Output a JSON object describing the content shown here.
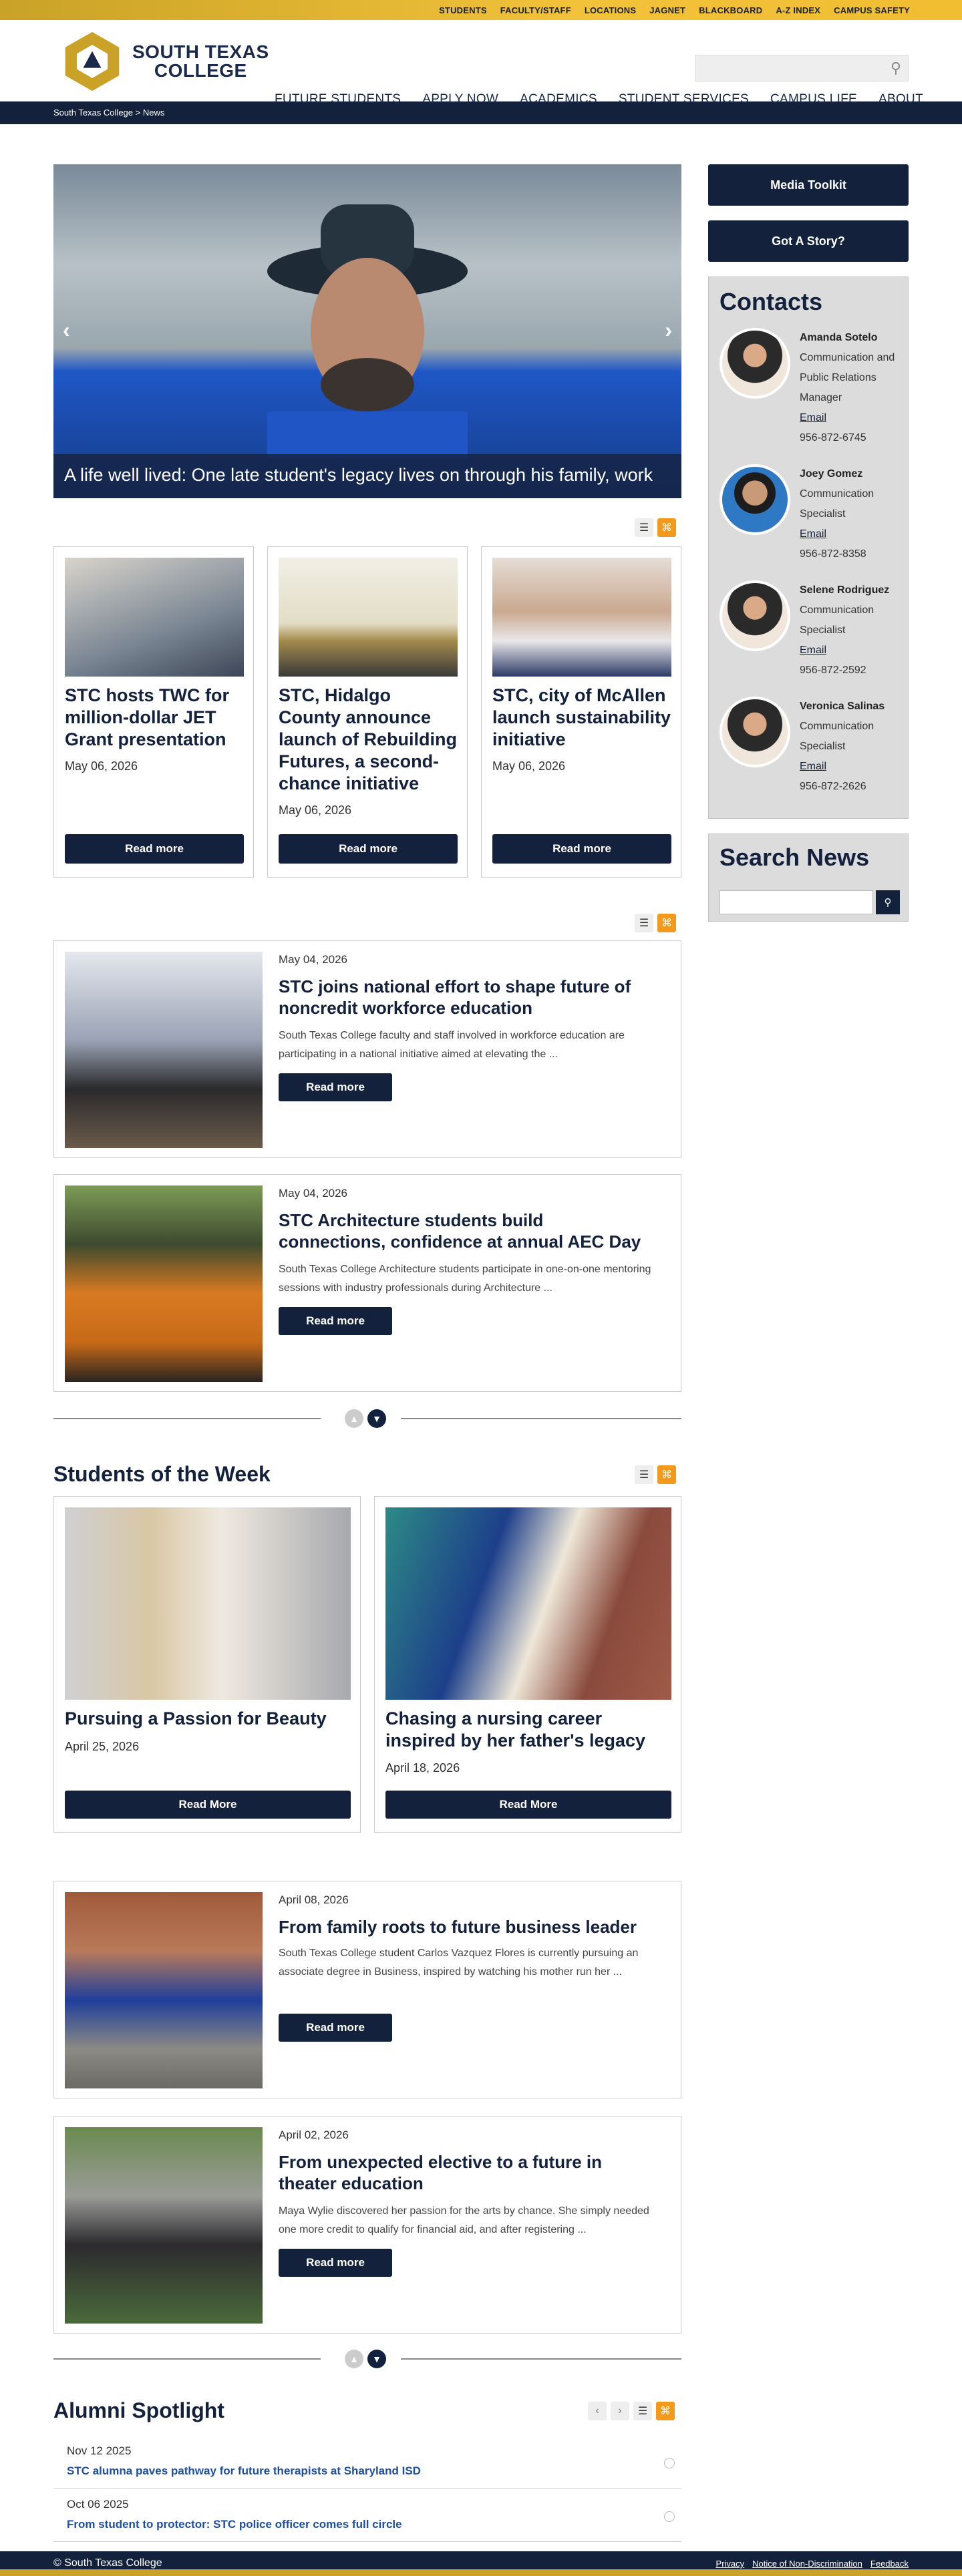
{
  "topbar": {
    "links": [
      "STUDENTS",
      "FACULTY/STAFF",
      "LOCATIONS",
      "JAGNET",
      "BLACKBOARD",
      "A-Z INDEX",
      "CAMPUS SAFETY"
    ]
  },
  "header": {
    "logo_line1": "SOUTH TEXAS",
    "logo_line2": "COLLEGE",
    "nav": [
      "FUTURE STUDENTS",
      "APPLY NOW",
      "ACADEMICS",
      "STUDENT SERVICES",
      "CAMPUS LIFE",
      "ABOUT"
    ]
  },
  "breadcrumb": "South Texas College > News",
  "hero": {
    "caption": "A life well lived: One late student's legacy lives on through his family, work"
  },
  "featured": [
    {
      "title": "STC hosts TWC for million-dollar JET Grant presentation",
      "date": "May 06, 2026",
      "button": "Read more"
    },
    {
      "title": "STC, Hidalgo County announce launch of Rebuilding Futures, a second-chance initiative",
      "date": "May 06, 2026",
      "button": "Read more"
    },
    {
      "title": "STC, city of McAllen launch sustainability initiative",
      "date": "May 06, 2026",
      "button": "Read more"
    }
  ],
  "news": [
    {
      "date": "May 04, 2026",
      "title": "STC joins national effort to shape future of noncredit workforce education",
      "summary": "South Texas College faculty and staff involved in workforce education are participating in a national initiative aimed at elevating the ...",
      "button": "Read more"
    },
    {
      "date": "May 04, 2026",
      "title": "STC Architecture students build connections, confidence at annual AEC Day",
      "summary": "South Texas College Architecture students participate in one-on-one mentoring sessions with industry professionals during Architecture ...",
      "button": "Read more"
    }
  ],
  "students_week": {
    "heading": "Students of the Week",
    "items": [
      {
        "title": "Pursuing a Passion for Beauty",
        "date": "April 25, 2026",
        "button": "Read More"
      },
      {
        "title": "Chasing a nursing career inspired by her father's legacy",
        "date": "April 18, 2026",
        "button": "Read More"
      }
    ]
  },
  "features": [
    {
      "date": "April 08, 2026",
      "title": "From family roots to future business leader",
      "summary": "South Texas College student Carlos Vazquez Flores is currently pursuing an associate degree in Business, inspired by watching his mother run her ...",
      "button": "Read more"
    },
    {
      "date": "April 02, 2026",
      "title": "From unexpected elective to a future in theater education",
      "summary": "Maya Wylie discovered her passion for the arts by chance. She simply needed one more credit to qualify for financial aid, and after registering ...",
      "button": "Read more"
    }
  ],
  "alumni": {
    "heading": "Alumni Spotlight",
    "items": [
      {
        "date": "Nov 12 2025",
        "title": "STC alumna paves pathway for future therapists at Sharyland ISD"
      },
      {
        "date": "Oct 06 2025",
        "title": "From student to protector: STC police officer comes full circle"
      }
    ]
  },
  "sidebar": {
    "media_toolkit": "Media Toolkit",
    "got_story": "Got A Story?",
    "contacts_heading": "Contacts",
    "contacts": [
      {
        "name": "Amanda Sotelo",
        "title": "Communication and Public Relations Manager",
        "email": "Email",
        "phone": "956-872-6745"
      },
      {
        "name": "Joey Gomez",
        "title": "Communication Specialist",
        "email": "Email",
        "phone": "956-872-8358"
      },
      {
        "name": "Selene Rodriguez",
        "title": "Communication Specialist",
        "email": "Email",
        "phone": "956-872-2592"
      },
      {
        "name": "Veronica Salinas",
        "title": "Communication Specialist",
        "email": "Email",
        "phone": "956-872-2626"
      }
    ],
    "search_heading": "Search News"
  },
  "footer": {
    "copyright": "© South Texas College",
    "links": [
      "Privacy",
      "Notice of Non-Discrimination",
      "Feedback"
    ]
  }
}
